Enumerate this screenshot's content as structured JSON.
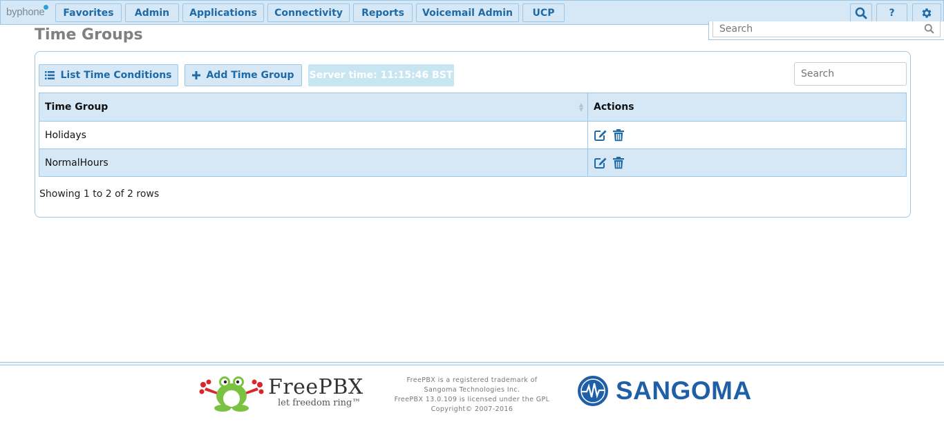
{
  "nav": {
    "logo": "byphone",
    "items": [
      "Favorites",
      "Admin",
      "Applications",
      "Connectivity",
      "Reports",
      "Voicemail Admin",
      "UCP"
    ],
    "help_label": "?"
  },
  "page_search": {
    "placeholder": "Search"
  },
  "page": {
    "title": "Time Groups"
  },
  "toolbar": {
    "list_label": "List Time Conditions",
    "add_label": "Add Time Group",
    "server_time": "Server time: 11:15:46 BST",
    "search_placeholder": "Search"
  },
  "table": {
    "headers": [
      "Time Group",
      "Actions"
    ],
    "rows": [
      {
        "name": "Holidays"
      },
      {
        "name": "NormalHours"
      }
    ],
    "footer": "Showing 1 to 2 of 2 rows"
  },
  "footer": {
    "brand": "FreePBX",
    "tagline": "let freedom ring™",
    "legal": [
      "FreePBX is a registered trademark of",
      "Sangoma Technologies Inc.",
      "FreePBX 13.0.109 is licensed under the GPL",
      "Copyright© 2007-2016"
    ],
    "sangoma": "SANGOMA"
  },
  "colors": {
    "accent": "#1e6aa8",
    "bar_bg": "#d6e8f6",
    "border": "#9cc6e6",
    "frog_green": "#7cc242",
    "frog_red": "#d9262c"
  },
  "icons": [
    "search-icon",
    "help-icon",
    "gear-icon",
    "list-icon",
    "plus-icon",
    "edit-icon",
    "trash-icon"
  ]
}
